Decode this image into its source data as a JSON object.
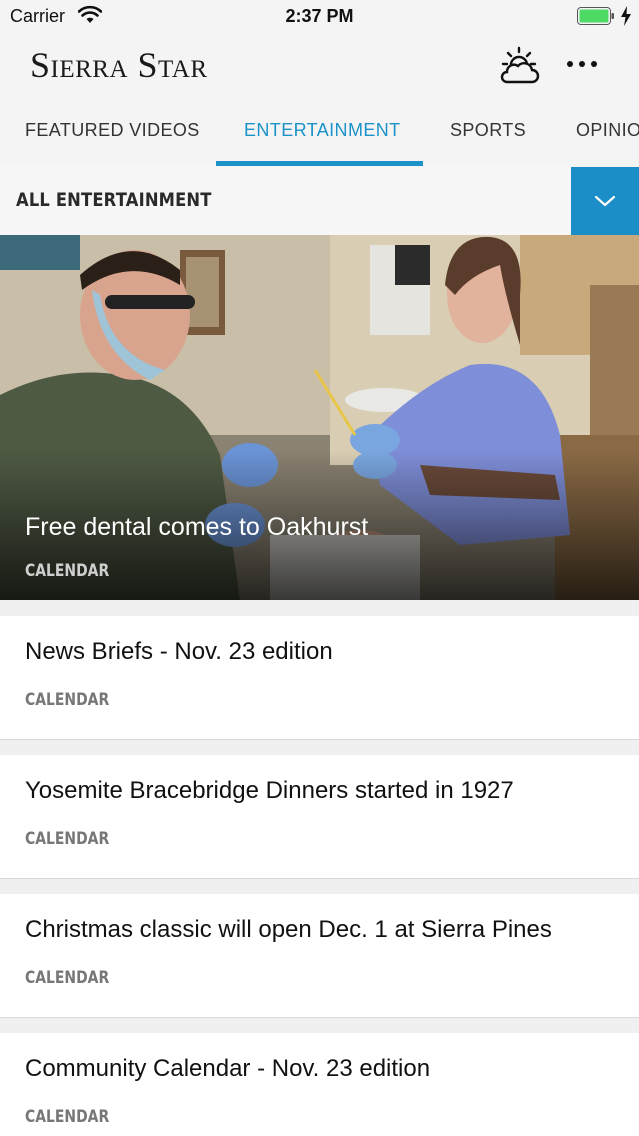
{
  "status_bar": {
    "carrier": "Carrier",
    "time": "2:37 PM",
    "battery_color": "#4cd964"
  },
  "header": {
    "logo": "Sierra Star",
    "weather_icon": "partly-cloudy-icon",
    "more_icon": "ellipsis-icon"
  },
  "tabs": [
    {
      "label": "FEATURED VIDEOS",
      "active": false
    },
    {
      "label": "ENTERTAINMENT",
      "active": true
    },
    {
      "label": "SPORTS",
      "active": false
    },
    {
      "label": "OPINION",
      "active": false
    }
  ],
  "accent_color": "#1b93c9",
  "section": {
    "title": "ALL ENTERTAINMENT",
    "dropdown_icon": "chevron-down-icon"
  },
  "hero": {
    "headline": "Free dental comes to Oakhurst",
    "category": "CALENDAR"
  },
  "stories": [
    {
      "headline": "News Briefs - Nov. 23 edition",
      "category": "CALENDAR"
    },
    {
      "headline": "Yosemite Bracebridge Dinners started in 1927",
      "category": "CALENDAR"
    },
    {
      "headline": "Christmas classic will open Dec. 1 at Sierra Pines",
      "category": "CALENDAR"
    },
    {
      "headline": "Community Calendar - Nov. 23 edition",
      "category": "CALENDAR"
    }
  ]
}
